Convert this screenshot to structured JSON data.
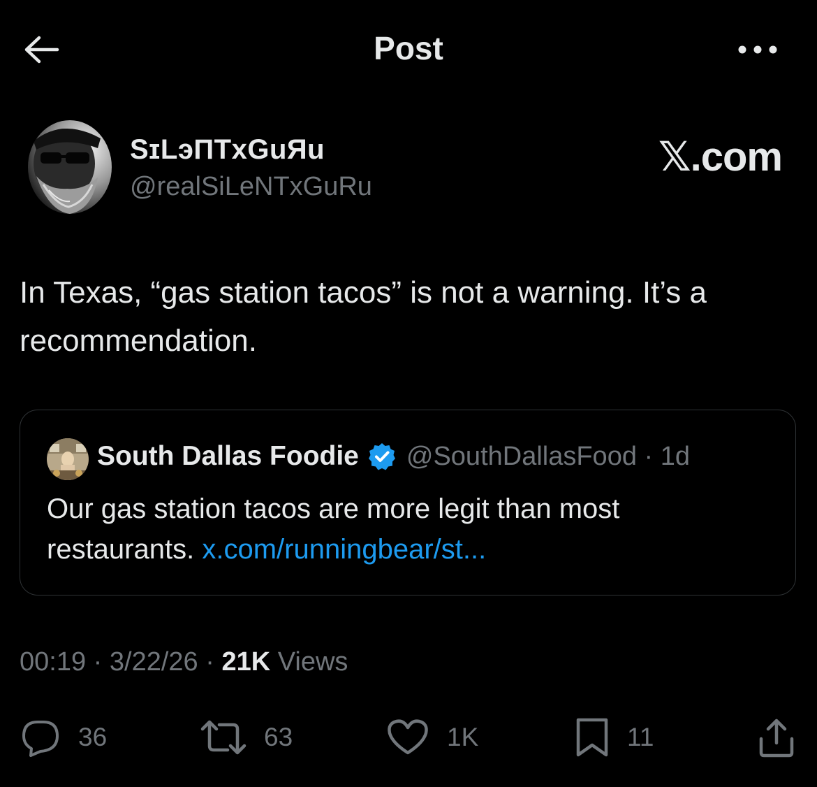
{
  "header": {
    "title": "Post",
    "back_icon": "back-arrow-icon",
    "more_icon": "more-dots-icon"
  },
  "author": {
    "display_name": "SɪLэПTxGuЯu",
    "handle": "@realSiLeNTxGuRu"
  },
  "brand": {
    "text": "𝕏.com"
  },
  "tweet": {
    "text": "In Texas, “gas station tacos” is not a warning. It’s a recommendation."
  },
  "quote": {
    "name": "South Dallas Foodie",
    "verified": true,
    "handle_time": "@SouthDallasFood · 1d",
    "text": "Our gas station tacos are more legit than most restaurants.",
    "link": "x.com/runningbear/st..."
  },
  "meta": {
    "time": "00:19",
    "date": "3/22/26",
    "views_count": "21K",
    "views_label": "Views",
    "sep": "·"
  },
  "actions": {
    "replies": "36",
    "reposts": "63",
    "likes": "1K",
    "bookmarks": "11"
  },
  "colors": {
    "background": "#000000",
    "text": "#e7e9ea",
    "secondary": "#71767b",
    "link": "#1d9bf0",
    "border": "#2f3336"
  }
}
